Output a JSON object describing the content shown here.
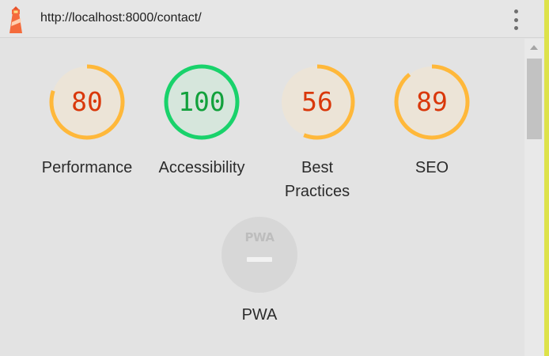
{
  "header": {
    "url": "http://localhost:8000/contact/",
    "logo_icon": "lighthouse-icon",
    "menu_icon": "more-vert-icon"
  },
  "colors": {
    "average": "#ffb83a",
    "average_text": "#d9380b",
    "average_fill": "#ece4d7",
    "pass": "#19d26b",
    "pass_text": "#12a13c",
    "pass_fill": "#d6e6dc"
  },
  "gauges": [
    {
      "label": "Performance",
      "score": 80,
      "display": "80",
      "rating": "average"
    },
    {
      "label": "Accessibility",
      "score": 100,
      "display": "100",
      "rating": "pass"
    },
    {
      "label": "Best Practices",
      "score": 56,
      "display": "56",
      "rating": "average"
    },
    {
      "label": "SEO",
      "score": 89,
      "display": "89",
      "rating": "average"
    }
  ],
  "pwa": {
    "badge_text": "PWA",
    "label": "PWA",
    "icon": "pwa-badge-icon"
  }
}
